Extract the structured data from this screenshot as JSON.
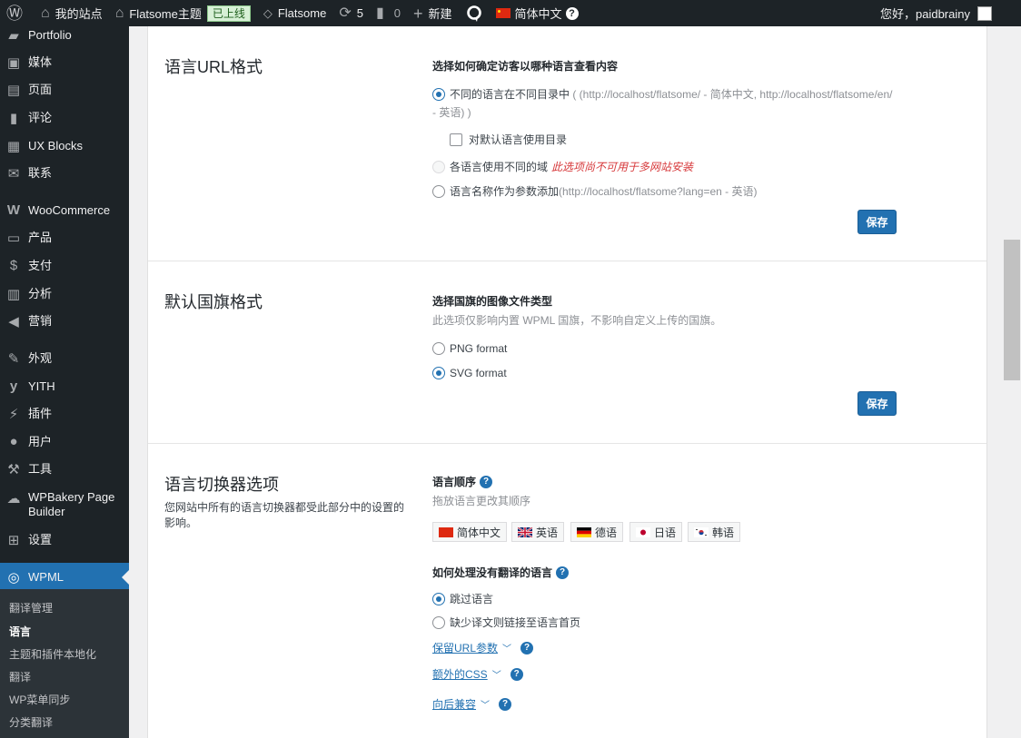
{
  "admin_bar": {
    "site_name": "我的站点",
    "theme_name": "Flatsome主题",
    "live_badge": "已上线",
    "flatsome": "Flatsome",
    "updates_count": "5",
    "comments_count": "0",
    "new_label": "新建",
    "language": "简体中文",
    "language_help": "?",
    "greeting": "您好，paidbrainy"
  },
  "sidebar": {
    "items": [
      {
        "label": "Portfolio",
        "icon": "portfolio-icon"
      },
      {
        "label": "媒体",
        "icon": "media-icon"
      },
      {
        "label": "页面",
        "icon": "pages-icon"
      },
      {
        "label": "评论",
        "icon": "comments-icon"
      },
      {
        "label": "UX Blocks",
        "icon": "blocks-icon"
      },
      {
        "label": "联系",
        "icon": "mail-icon"
      },
      {
        "label": "WooCommerce",
        "icon": "woocommerce-icon"
      },
      {
        "label": "产品",
        "icon": "products-icon"
      },
      {
        "label": "支付",
        "icon": "payments-icon"
      },
      {
        "label": "分析",
        "icon": "analytics-icon"
      },
      {
        "label": "营销",
        "icon": "marketing-icon"
      },
      {
        "label": "外观",
        "icon": "appearance-icon"
      },
      {
        "label": "YITH",
        "icon": "yith-icon"
      },
      {
        "label": "插件",
        "icon": "plugins-icon"
      },
      {
        "label": "用户",
        "icon": "users-icon"
      },
      {
        "label": "工具",
        "icon": "tools-icon"
      },
      {
        "label": "WPBakery Page Builder",
        "icon": "wpbakery-icon"
      },
      {
        "label": "设置",
        "icon": "settings-icon"
      },
      {
        "label": "WPML",
        "icon": "wpml-icon"
      }
    ],
    "submenu": [
      "翻译管理",
      "语言",
      "主题和插件本地化",
      "翻译",
      "WP菜单同步",
      "分类翻译"
    ]
  },
  "url_format": {
    "title": "语言URL格式",
    "heading": "选择如何确定访客以哪种语言查看内容",
    "opt1_label": "不同的语言在不同目录中",
    "opt1_hint_a": " ( (http://localhost/flatsome/ - 简体中文, http://localhost/flatsome/en/",
    "opt1_hint_b": "- 英语) )",
    "opt1_checkbox": "对默认语言使用目录",
    "opt2_label": "各语言使用不同的域",
    "opt2_warning": "此选项尚不可用于多网站安装",
    "opt3_label": "语言名称作为参数添加",
    "opt3_hint": " (http://localhost/flatsome?lang=en - 英语)",
    "save": "保存"
  },
  "flag_format": {
    "title": "默认国旗格式",
    "heading": "选择国旗的图像文件类型",
    "subtext": "此选项仅影响内置 WPML 国旗，不影响自定义上传的国旗。",
    "opt_png": "PNG format",
    "opt_svg": "SVG format",
    "save": "保存"
  },
  "switcher": {
    "title": "语言切换器选项",
    "description": "您网站中所有的语言切换器都受此部分中的设置的影响。",
    "order_heading": "语言顺序",
    "order_sub": "拖放语言更改其顺序",
    "languages": [
      "简体中文",
      "英语",
      "德语",
      "日语",
      "韩语"
    ],
    "untranslated_heading": "如何处理没有翻译的语言",
    "opt_skip": "跳过语言",
    "opt_link_home": "缺少译文则链接至语言首页",
    "link_url_params": "保留URL参数",
    "link_extra_css": "额外的CSS",
    "link_backward": "向后兼容"
  }
}
